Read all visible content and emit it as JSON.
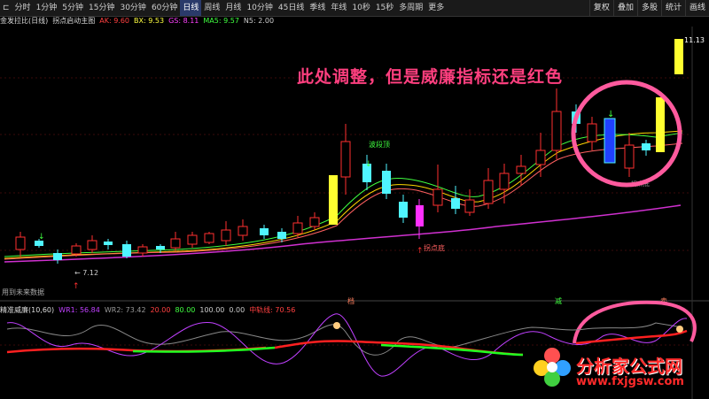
{
  "toolbar": {
    "items": [
      "⊏",
      "分时",
      "1分钟",
      "5分钟",
      "15分钟",
      "30分钟",
      "60分钟",
      "日线",
      "周线",
      "月线",
      "10分钟",
      "45日线",
      "季线",
      "年线",
      "10秒",
      "15秒",
      "多周期",
      "更多"
    ],
    "active_index": 7,
    "right_buttons": [
      "复权",
      "叠加",
      "多股",
      "统计",
      "画线"
    ]
  },
  "info_line": {
    "title": "金发拉比(日线)",
    "subtitle": "拐点启动主图",
    "ak": "AK: 9.60",
    "bx": "BX: 9.53",
    "gs": "GS: 8.11",
    "ma5": "MA5: 9.57",
    "n5": "N5: 2.00"
  },
  "chart_labels": {
    "low_price": "7.12",
    "boduan_top": "波段顶",
    "guaidian_di": "拐点底",
    "future_data": "用到未来数据",
    "price_top": "11.13",
    "circle_note": "拐点底",
    "sig_left": "档",
    "sig_mid": "减",
    "sig_right": "卖"
  },
  "annotation": "此处调整，但是威廉指标还是红色",
  "indicator_line": {
    "name": "精准威廉(10,60)",
    "wr1": "WR1: 56.84",
    "wr2": "WR2: 73.42",
    "v1": "20.00",
    "v2": "80.00",
    "v3": "100.00",
    "v4": "0.00",
    "mid": "中轨线: 70.56"
  },
  "logo": {
    "title": "分析家公式网",
    "url": "www.fxjgsw.com"
  },
  "colors": {
    "up_candle": "#ff3030",
    "down_candle": "#4ff5ff",
    "signal_yellow": "#ffff30",
    "signal_magenta": "#ff30ff",
    "signal_blue": "#2040ff",
    "annotation": "#ff3f7f",
    "wr_red": "#ff2020",
    "wr_green": "#20ff20"
  }
}
